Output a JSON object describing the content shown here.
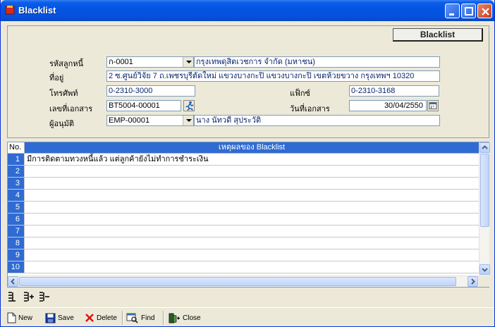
{
  "window": {
    "title": "Blacklist"
  },
  "form": {
    "header_button": "Blacklist",
    "debtor_code_label": "รหัสลูกหนี้",
    "debtor_code_value": "ก-0001",
    "debtor_name_value": "กรุงเทพดุสิตเวชการ จำกัด (มหาชน)",
    "address_label": "ที่อยู่",
    "address_value": "2 ซ.ศูนย์วิจัย 7 ถ.เพชรบุรีตัดใหม่  แขวงบางกะปิ แขวงบางกะปิ เขตห้วยขวาง กรุงเทพฯ 10320",
    "phone_label": "โทรศัพท์",
    "phone_value": "0-2310-3000",
    "fax_label": "แฟ็กซ์",
    "fax_value": "0-2310-3168",
    "doc_no_label": "เลขที่เอกสาร",
    "doc_no_value": "BT5004-00001",
    "doc_date_label": "วันที่เอกสาร",
    "doc_date_value": "30/04/2550",
    "approver_label": "ผู้อนุมัติ",
    "approver_code_value": "EMP-00001",
    "approver_name_value": "นาง นัทวดี สุประวัติ"
  },
  "grid": {
    "col_no": "No.",
    "col_reason": "เหตุผลของ Blacklist",
    "rows": [
      {
        "no": "1",
        "text": "มีการติดตามทวงหนี้แล้ว แต่ลูกค้ายังไม่ทำการชำระเงิน"
      },
      {
        "no": "2",
        "text": ""
      },
      {
        "no": "3",
        "text": ""
      },
      {
        "no": "4",
        "text": ""
      },
      {
        "no": "5",
        "text": ""
      },
      {
        "no": "6",
        "text": ""
      },
      {
        "no": "7",
        "text": ""
      },
      {
        "no": "8",
        "text": ""
      },
      {
        "no": "9",
        "text": ""
      },
      {
        "no": "10",
        "text": ""
      }
    ]
  },
  "toolbar": {
    "new_label": "New",
    "save_label": "Save",
    "delete_label": "Delete",
    "find_label": "Find",
    "close_label": "Close"
  },
  "colors": {
    "titlebar": "#0554e3",
    "row_number_bg": "#2f6bd3",
    "header_bg": "#2f6bd3",
    "window_bg": "#ece9d8"
  },
  "icons": [
    "app-icon",
    "minimize-icon",
    "maximize-icon",
    "close-icon",
    "dropdown-arrow-icon",
    "runner-search-icon",
    "calendar-icon",
    "insert-row-icon",
    "add-row-icon",
    "delete-row-icon",
    "new-document-icon",
    "save-disk-icon",
    "delete-x-icon",
    "find-icon",
    "close-door-icon"
  ]
}
